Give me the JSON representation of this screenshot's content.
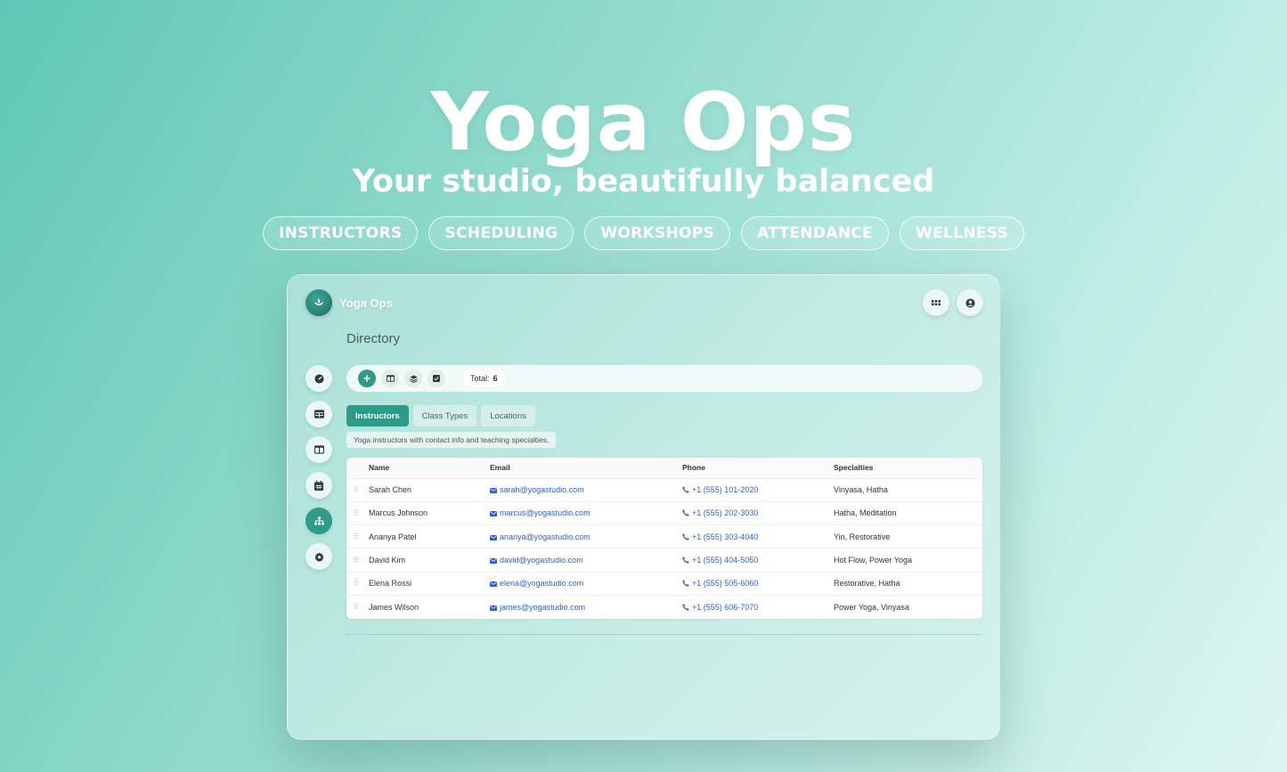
{
  "hero": {
    "title": "Yoga Ops",
    "subtitle": "Your studio, beautifully balanced",
    "pills": [
      "INSTRUCTORS",
      "SCHEDULING",
      "WORKSHOPS",
      "ATTENDANCE",
      "WELLNESS"
    ]
  },
  "app": {
    "brand": "Yoga Ops",
    "page_title": "Directory",
    "total_label": "Total:",
    "total_value": "6",
    "tabs": [
      "Instructors",
      "Class Types",
      "Locations"
    ],
    "description": "Yoga instructors with contact info and teaching specialties.",
    "sidebar_icons": [
      "dashboard-icon",
      "table-icon",
      "columns-icon",
      "calendar-icon",
      "hierarchy-icon",
      "gear-icon"
    ],
    "accent_color": "#2f9a88",
    "link_color": "#2e5fd1"
  },
  "table": {
    "headers": [
      "Name",
      "Email",
      "Phone",
      "Specialties"
    ],
    "rows": [
      {
        "name": "Sarah Chen",
        "email": "sarah@yogastudio.com",
        "phone": "+1 (555) 101-2020",
        "specialties": "Vinyasa, Hatha"
      },
      {
        "name": "Marcus Johnson",
        "email": "marcus@yogastudio.com",
        "phone": "+1 (555) 202-3030",
        "specialties": "Hatha, Meditation"
      },
      {
        "name": "Ananya Patel",
        "email": "ananya@yogastudio.com",
        "phone": "+1 (555) 303-4040",
        "specialties": "Yin, Restorative"
      },
      {
        "name": "David Kim",
        "email": "david@yogastudio.com",
        "phone": "+1 (555) 404-5050",
        "specialties": "Hot Flow, Power Yoga"
      },
      {
        "name": "Elena Rossi",
        "email": "elena@yogastudio.com",
        "phone": "+1 (555) 505-6060",
        "specialties": "Restorative, Hatha"
      },
      {
        "name": "James Wilson",
        "email": "james@yogastudio.com",
        "phone": "+1 (555) 606-7070",
        "specialties": "Power Yoga, Vinyasa"
      }
    ]
  }
}
